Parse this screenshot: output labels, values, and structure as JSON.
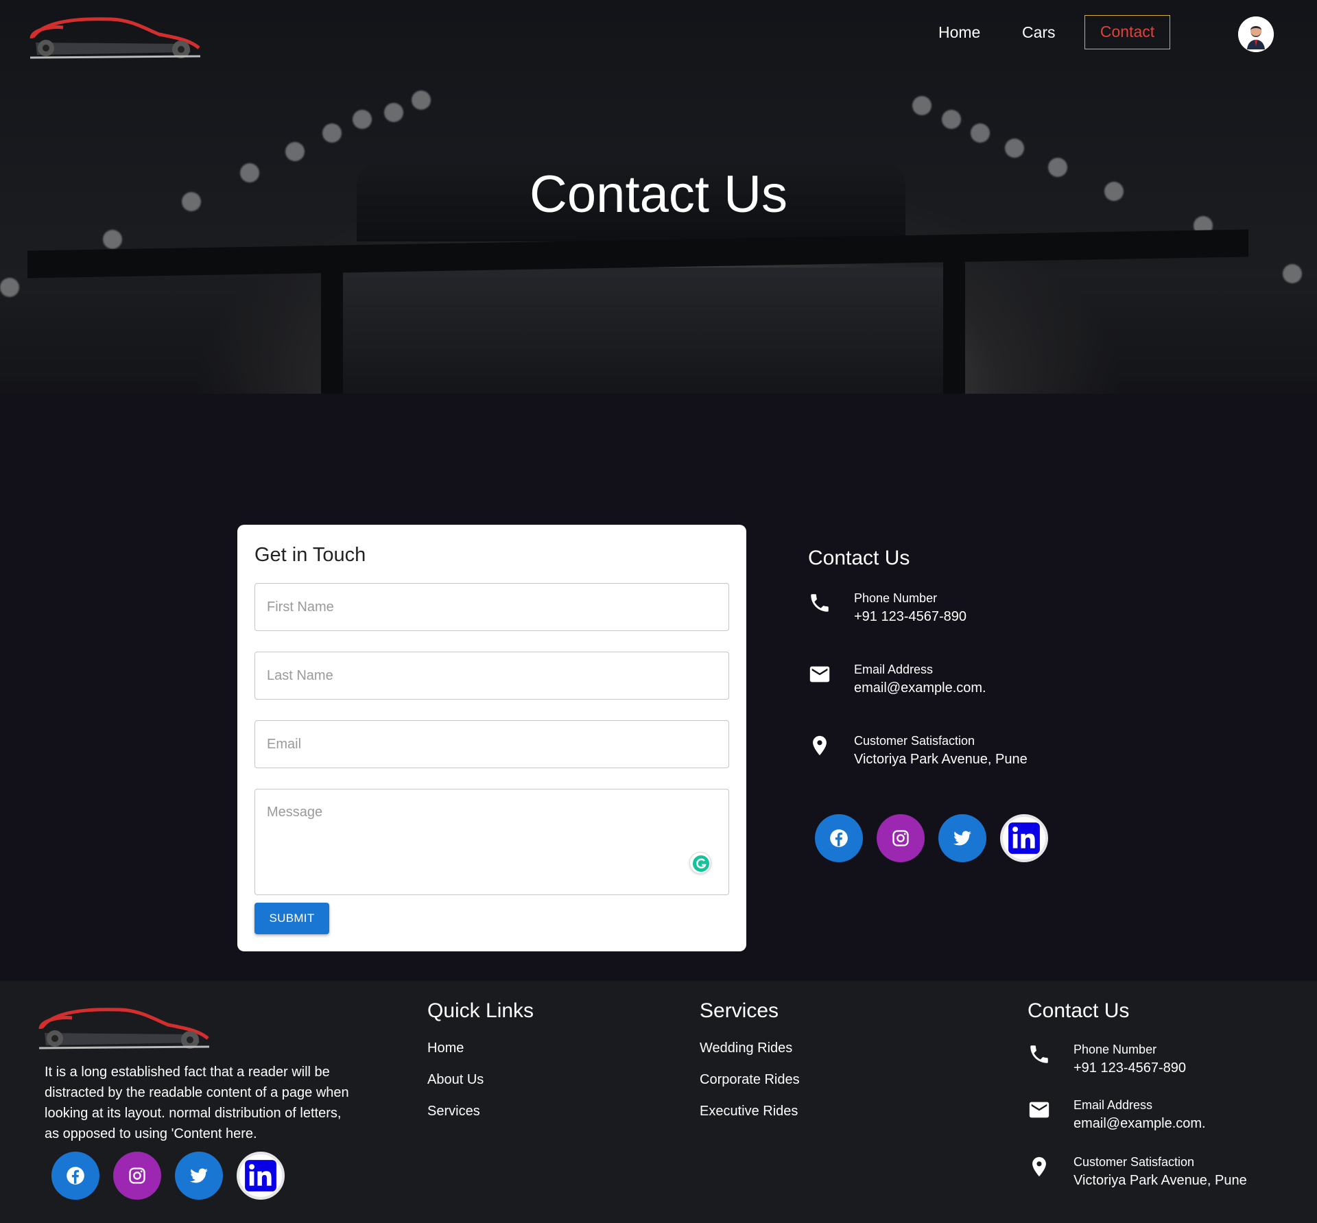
{
  "nav": {
    "items": [
      {
        "label": "Home"
      },
      {
        "label": "Cars"
      },
      {
        "label": "Contact"
      }
    ]
  },
  "hero": {
    "title": "Contact Us"
  },
  "form": {
    "title": "Get in Touch",
    "first_name_placeholder": "First Name",
    "last_name_placeholder": "Last Name",
    "email_placeholder": "Email",
    "message_placeholder": "Message",
    "submit_label": "SUBMIT"
  },
  "contact": {
    "title": "Contact Us",
    "phone_label": "Phone Number",
    "phone_value": "+91 123-4567-890",
    "email_label": "Email Address",
    "email_value": "email@example.com.",
    "address_label": "Customer Satisfaction",
    "address_value": "Victoriya Park Avenue, Pune"
  },
  "social": [
    "facebook-icon",
    "instagram-icon",
    "twitter-icon",
    "linkedin-icon"
  ],
  "footer": {
    "about": "It is a long established fact that a reader will be distracted by the readable content of a page when looking at its layout. normal distribution of letters, as opposed to using 'Content here.",
    "quick_links_title": "Quick Links",
    "quick_links": [
      "Home",
      "About Us",
      "Services"
    ],
    "services_title": "Services",
    "services": [
      "Wedding Rides",
      "Corporate Rides",
      "Executive Rides"
    ],
    "contact_title": "Contact Us",
    "phone_label": "Phone Number",
    "phone_value": "+91 123-4567-890",
    "email_label": "Email Address",
    "email_value": "email@example.com.",
    "address_label": "Customer Satisfaction",
    "address_value": "Victoriya Park Avenue, Pune"
  },
  "colors": {
    "page_bg": "#12111a",
    "footer_bg": "#1a1b1f",
    "accent_blue": "#1976d2",
    "instagram_purple": "#9c27b0",
    "nav_active_text": "#e0423a",
    "nav_active_border": "#d4b13a"
  }
}
